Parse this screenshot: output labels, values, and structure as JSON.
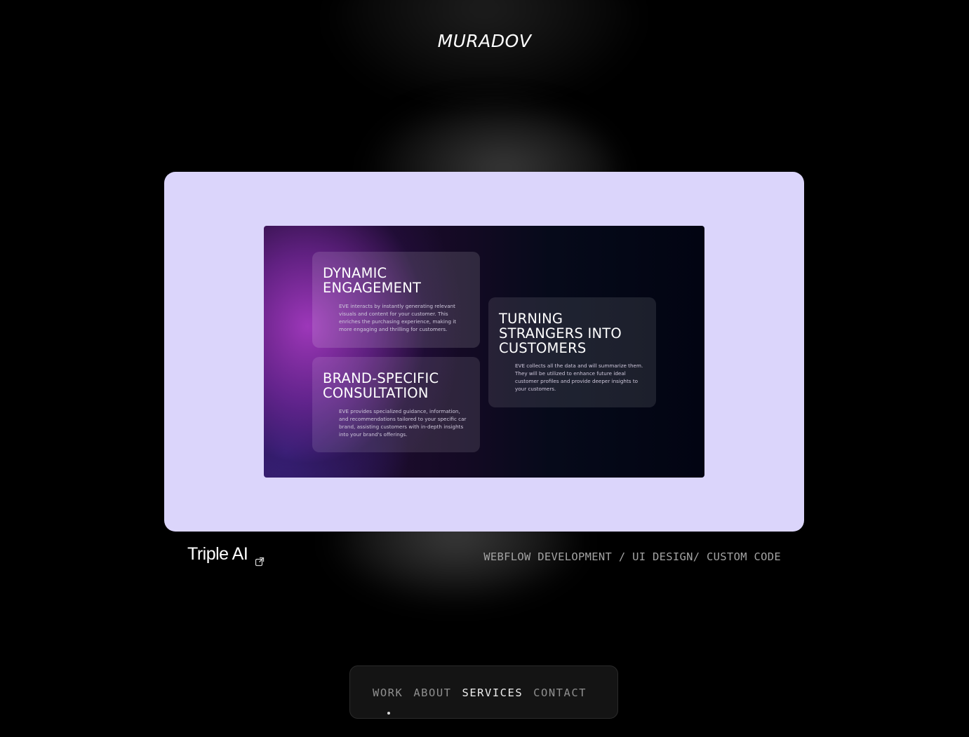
{
  "brand": {
    "logo_text": "MURADOV"
  },
  "project": {
    "title": "Triple AI",
    "tags": "WEBFLOW DEVELOPMENT / UI DESIGN/ CUSTOM CODE",
    "link_icon": "external-link-icon",
    "card_color": "#dbd5fb"
  },
  "preview": {
    "features": [
      {
        "title_line1": "DYNAMIC",
        "title_line2": "ENGAGEMENT",
        "body": "EVE interacts by instantly generating relevant visuals and content for your customer. This enriches the purchasing experience, making it more engaging and thrilling for customers."
      },
      {
        "title_line1": "BRAND-SPECIFIC",
        "title_line2": "CONSULTATION",
        "body": "EVE provides specialized guidance, information, and recommendations tailored to your specific car brand, assisting customers with in-depth insights into your brand's offerings."
      },
      {
        "title_line1": "TURNING",
        "title_line2": "STRANGERS INTO",
        "title_line3": "CUSTOMERS",
        "body": "EVE collects all the data and will summarize them. They will be utilized to enhance future ideal customer profiles and provide deeper insights to your customers."
      }
    ]
  },
  "nav": {
    "items": [
      {
        "label": "WORK",
        "active": false
      },
      {
        "label": "ABOUT",
        "active": false
      },
      {
        "label": "SERVICES",
        "active": true
      },
      {
        "label": "CONTACT",
        "active": false
      }
    ],
    "indicator_on": "WORK"
  }
}
